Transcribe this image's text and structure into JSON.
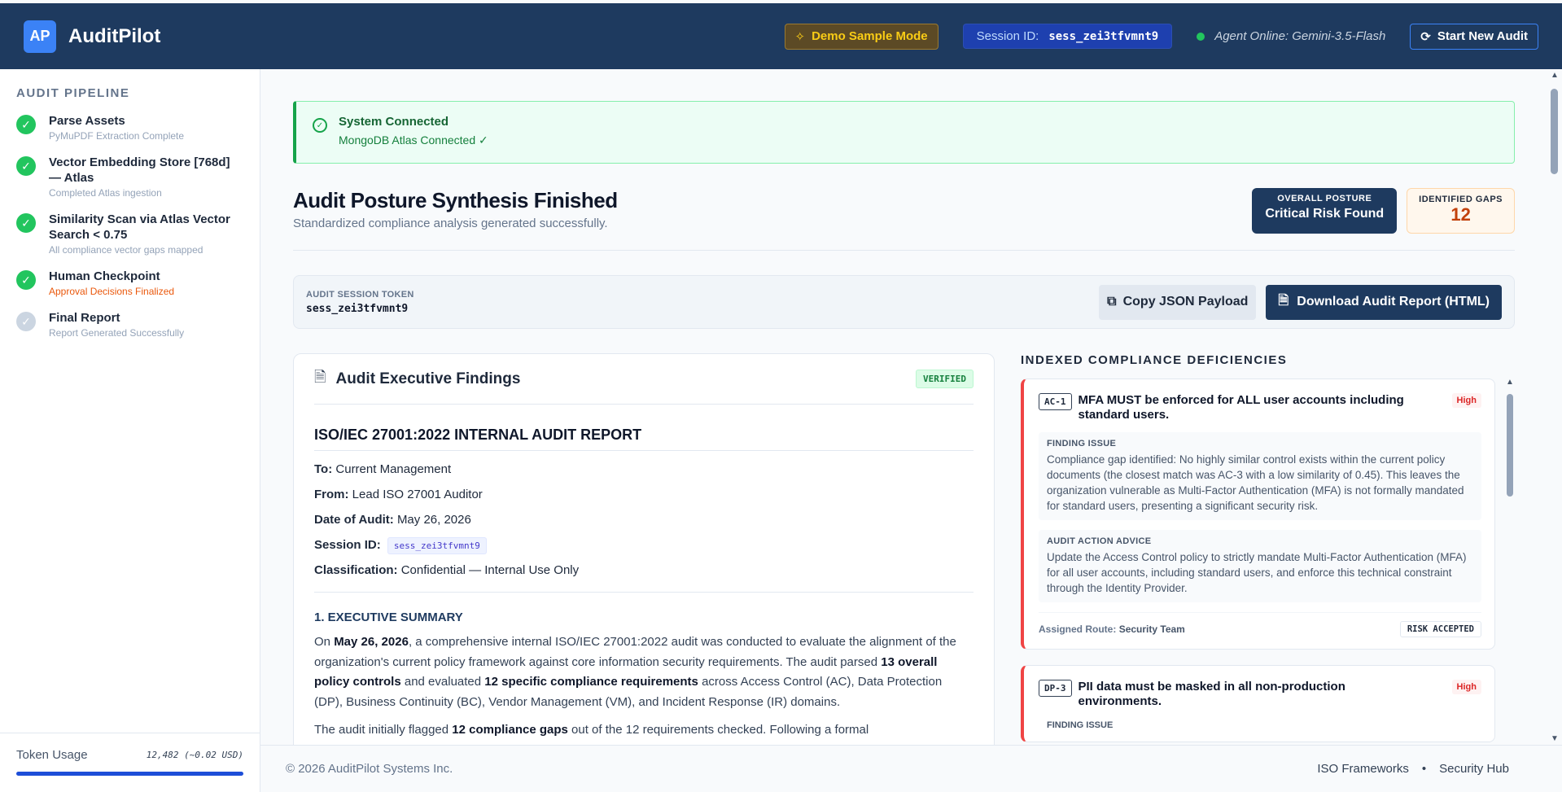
{
  "app": {
    "logo_initials": "AP",
    "name": "AuditPilot"
  },
  "topbar": {
    "demo_label": "Demo Sample Mode",
    "session_label": "Session ID:",
    "session_id": "sess_zei3tfvmnt9",
    "agent_status": "Agent Online: Gemini-3.5-Flash",
    "new_audit_label": "Start New Audit"
  },
  "sidebar": {
    "heading": "AUDIT PIPELINE",
    "steps": [
      {
        "title": "Parse Assets",
        "sub": "PyMuPDF Extraction Complete",
        "status": "done"
      },
      {
        "title": "Vector Embedding Store [768d] — Atlas",
        "sub": "Completed Atlas ingestion",
        "status": "done"
      },
      {
        "title": "Similarity Scan via Atlas Vector Search < 0.75",
        "sub": "All compliance vector gaps mapped",
        "status": "done"
      },
      {
        "title": "Human Checkpoint",
        "sub": "Approval Decisions Finalized",
        "status": "done"
      },
      {
        "title": "Final Report",
        "sub": "Report Generated Successfully",
        "status": "pending"
      }
    ],
    "token_label": "Token Usage",
    "token_value": "12,482 (~0.02 USD)"
  },
  "connection": {
    "title": "System Connected",
    "sub": "MongoDB Atlas Connected ✓"
  },
  "header": {
    "title": "Audit Posture Synthesis Finished",
    "subtitle": "Standardized compliance analysis generated successfully.",
    "posture_label": "OVERALL POSTURE",
    "posture_value": "Critical Risk Found",
    "gaps_label": "IDENTIFIED GAPS",
    "gaps_value": "12"
  },
  "token_card": {
    "label": "AUDIT SESSION TOKEN",
    "value": "sess_zei3tfvmnt9",
    "copy_label": "Copy JSON Payload",
    "download_label": "Download Audit Report (HTML)"
  },
  "findings": {
    "title": "Audit Executive Findings",
    "badge": "VERIFIED",
    "report_title": "ISO/IEC 27001:2022 INTERNAL AUDIT REPORT",
    "to_label": "To:",
    "to_value": "Current Management",
    "from_label": "From:",
    "from_value": "Lead ISO 27001 Auditor",
    "date_label": "Date of Audit:",
    "date_value": "May 26, 2026",
    "session_label": "Session ID:",
    "session_value": "sess_zei3tfvmnt9",
    "class_label": "Classification:",
    "class_value": "Confidential — Internal Use Only",
    "section1": "1. EXECUTIVE SUMMARY",
    "p1_a": "On ",
    "p1_date": "May 26, 2026",
    "p1_b": ", a comprehensive internal ISO/IEC 27001:2022 audit was conducted to evaluate the alignment of the organization's current policy framework against core information security requirements. The audit parsed ",
    "p1_c": "13 overall policy controls",
    "p1_d": " and evaluated ",
    "p1_e": "12 specific compliance requirements",
    "p1_f": " across Access Control (AC), Data Protection (DP), Business Continuity (BC), Vendor Management (VM), and Incident Response (IR) domains.",
    "p2_a": "The audit initially flagged ",
    "p2_b": "12 compliance gaps",
    "p2_c": " out of the 12 requirements checked. Following a formal"
  },
  "deficiencies": {
    "heading": "INDEXED COMPLIANCE DEFICIENCIES",
    "items": [
      {
        "id": "AC-1",
        "title": "MFA MUST be enforced for ALL user accounts including standard users.",
        "severity": "High",
        "issue_label": "FINDING ISSUE",
        "issue": "Compliance gap identified: No highly similar control exists within the current policy documents (the closest match was AC-3 with a low similarity of 0.45). This leaves the organization vulnerable as Multi-Factor Authentication (MFA) is not formally mandated for standard users, presenting a significant security risk.",
        "advice_label": "AUDIT ACTION ADVICE",
        "advice": "Update the Access Control policy to strictly mandate Multi-Factor Authentication (MFA) for all user accounts, including standard users, and enforce this technical constraint through the Identity Provider.",
        "route_label": "Assigned Route:",
        "route": "Security Team",
        "status": "RISK ACCEPTED"
      },
      {
        "id": "DP-3",
        "title": "PII data must be masked in all non-production environments.",
        "severity": "High",
        "issue_label": "FINDING ISSUE"
      }
    ]
  },
  "footer": {
    "copyright": "© 2026 AuditPilot Systems Inc.",
    "link1": "ISO Frameworks",
    "separator": "•",
    "link2": "Security Hub"
  }
}
